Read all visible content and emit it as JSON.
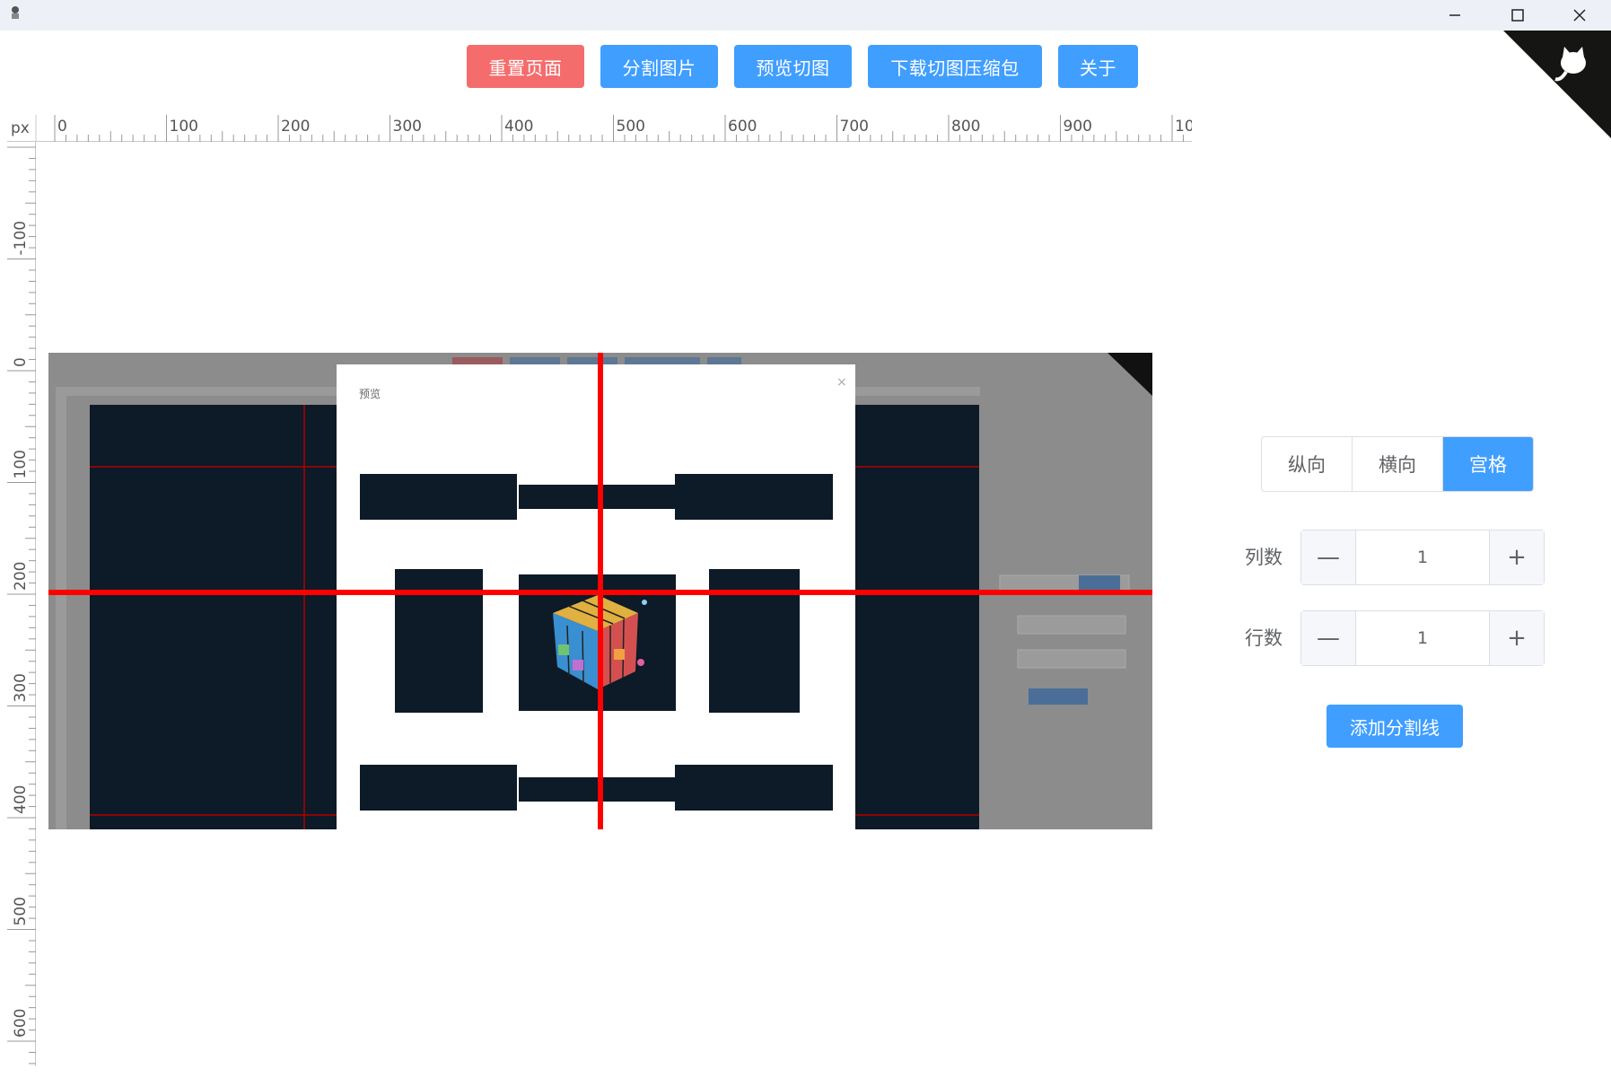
{
  "titlebar": {
    "minimize_icon": "minimize-icon",
    "maximize_icon": "maximize-icon",
    "close_icon": "close-icon"
  },
  "toolbar": {
    "reset_label": "重置页面",
    "split_label": "分割图片",
    "preview_label": "预览切图",
    "download_label": "下载切图压缩包",
    "about_label": "关于"
  },
  "ruler": {
    "unit": "px",
    "h_labels": [
      "0",
      "100",
      "200",
      "300",
      "400",
      "500",
      "600",
      "700",
      "800",
      "900",
      "10"
    ],
    "v_labels": [
      "-100",
      "0",
      "100",
      "200",
      "300",
      "400",
      "500",
      "600"
    ]
  },
  "preview": {
    "dialog_title": "预览",
    "close_symbol": "×"
  },
  "panel": {
    "modes": [
      "纵向",
      "横向",
      "宫格"
    ],
    "active_mode": "宫格",
    "columns_label": "列数",
    "columns_value": "1",
    "rows_label": "行数",
    "rows_value": "1",
    "minus": "—",
    "plus": "+",
    "add_line_label": "添加分割线"
  },
  "colors": {
    "primary": "#409eff",
    "danger": "#f56c6c",
    "split_line": "#ff0000",
    "dark_tile": "#0d1a27"
  }
}
